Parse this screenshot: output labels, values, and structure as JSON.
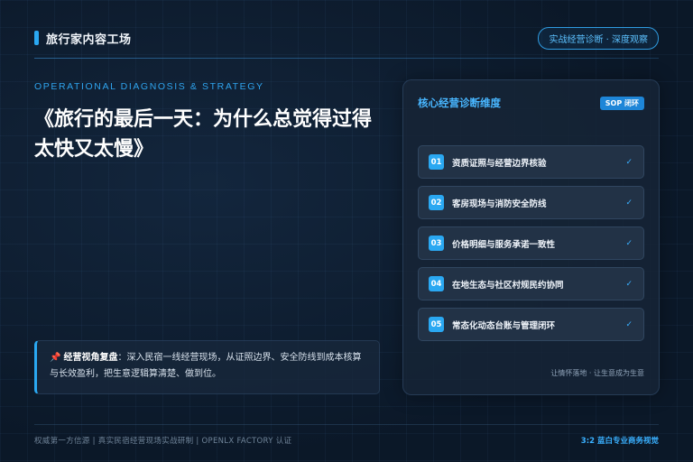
{
  "header": {
    "title": "旅行家内容工场",
    "badge": "实战经营诊断 · 深度观察"
  },
  "hero": {
    "eyebrow": "OPERATIONAL DIAGNOSIS & STRATEGY",
    "title": "《旅行的最后一天：为什么总觉得过得太快又太慢》"
  },
  "insight": {
    "icon": "pushpin-icon",
    "lead": "经营视角复盘",
    "text": "：深入民宿一线经营现场，从证照边界、安全防线到成本核算与长效盈利，把生意逻辑算清楚、做到位。"
  },
  "panel": {
    "title": "核心经营诊断维度",
    "badge": "SOP 闭环",
    "items": [
      {
        "num": "01",
        "label": "资质证照与经营边界核验",
        "check": "✓"
      },
      {
        "num": "02",
        "label": "客房现场与消防安全防线",
        "check": "✓"
      },
      {
        "num": "03",
        "label": "价格明细与服务承诺一致性",
        "check": "✓"
      },
      {
        "num": "04",
        "label": "在地生态与社区村规民约协同",
        "check": "✓"
      },
      {
        "num": "05",
        "label": "常态化动态台账与管理闭环",
        "check": "✓"
      }
    ],
    "footer": "让情怀落地 · 让生意成为生意"
  },
  "footer": {
    "left": "权威第一方信源 | 真实民宿经营现场实战研制 | OPENLX FACTORY 认证",
    "right": "3:2 蓝白专业商务视觉"
  },
  "colors": {
    "accent": "#2aa8f2",
    "background": "#0c1a2b"
  }
}
